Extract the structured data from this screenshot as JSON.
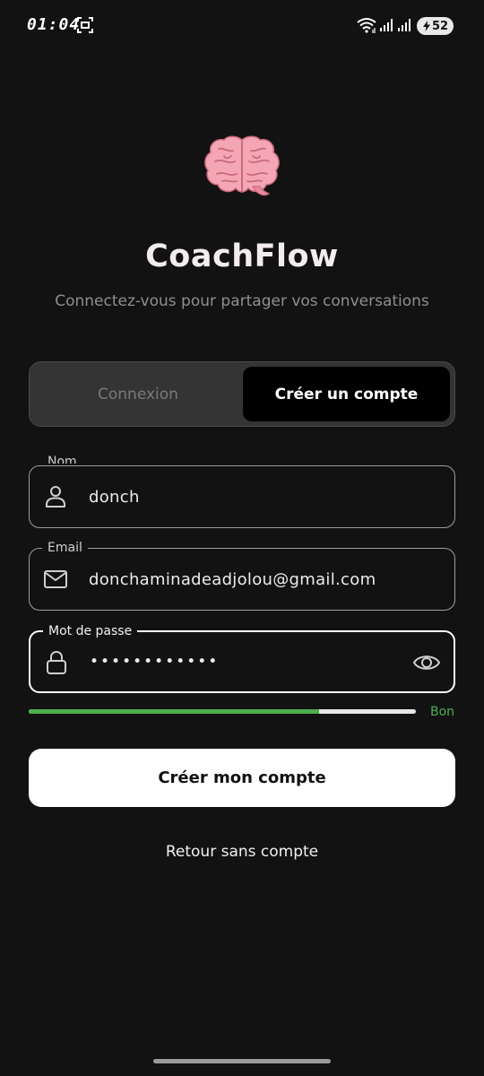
{
  "status_bar": {
    "time": "01:04",
    "battery_level": "52"
  },
  "app": {
    "title": "CoachFlow",
    "subtitle": "Connectez-vous pour partager vos conversations",
    "logo_icon": "brain-icon"
  },
  "tabs": {
    "login_label": "Connexion",
    "signup_label": "Créer un compte",
    "active": "signup"
  },
  "form": {
    "name": {
      "label": "Nom",
      "value": "donch",
      "icon": "user-icon"
    },
    "email": {
      "label": "Email",
      "value": "donchaminadeadjolou@gmail.com",
      "icon": "mail-icon"
    },
    "password": {
      "label": "Mot de passe",
      "value_masked": "••••••••••••",
      "icon": "lock-icon",
      "toggle_icon": "eye-icon"
    },
    "strength": {
      "label": "Bon",
      "level": 0.75,
      "color": "#4caf50"
    }
  },
  "actions": {
    "submit_label": "Créer mon compte",
    "skip_label": "Retour sans compte"
  },
  "colors": {
    "background": "#121212",
    "accent": "#4caf50",
    "primary_button": "#ffffff"
  }
}
